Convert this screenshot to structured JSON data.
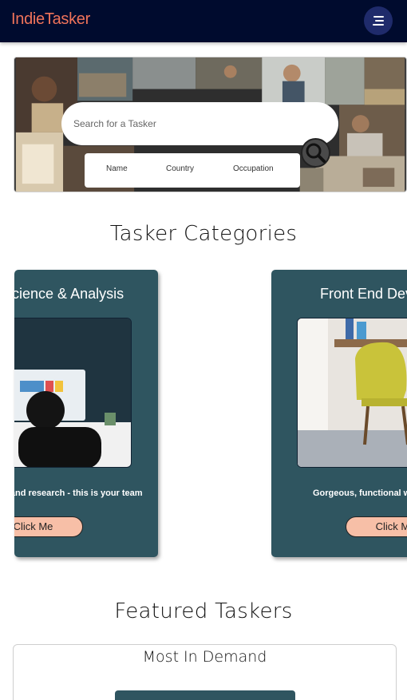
{
  "header": {
    "brand": "IndieTasker",
    "menu_icon": "hamburger-menu-icon",
    "brand_color": "#f0735a",
    "background_color": "#000b2e"
  },
  "search": {
    "placeholder": "Search for a Tasker",
    "button_icon": "magnifier-icon",
    "filters": [
      "Name",
      "Country",
      "Occupation"
    ]
  },
  "categories": {
    "title": "Tasker Categories",
    "cards": [
      {
        "title": "Data Science & Analysis",
        "description": "Data and research - this is your team",
        "button": "Click Me"
      },
      {
        "title": "Front End Development",
        "description": "Gorgeous, functional websites",
        "button": "Click Me"
      }
    ],
    "card_color": "#2f5560",
    "button_color": "#f7bfa7"
  },
  "featured": {
    "title": "Featured Taskers",
    "subtitle": "Most In Demand"
  }
}
